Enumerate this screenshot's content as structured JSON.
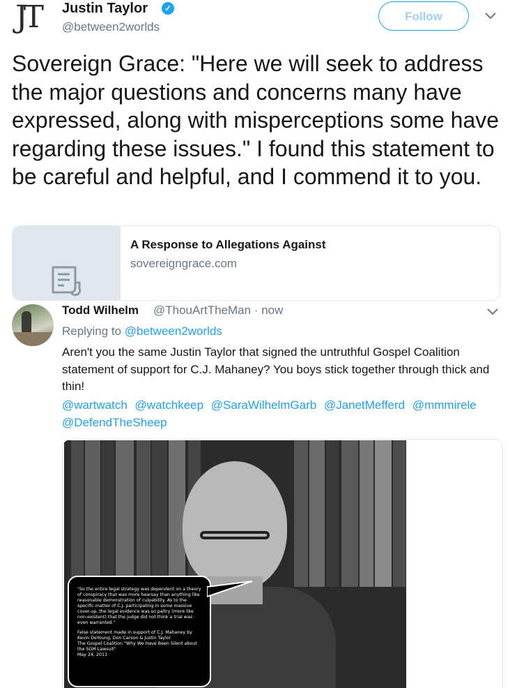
{
  "header": {
    "logo_text": "JT",
    "author_name": "Justin Taylor",
    "verified_icon": "verified-badge-icon",
    "handle": "@between2worlds",
    "follow_label": "Follow",
    "menu_icon": "chevron-down-icon"
  },
  "tweet": {
    "text": "Sovereign Grace: \"Here we will seek to address the major questions and concerns many have expressed, along with misperceptions some have regarding these issues.\" I found this statement to be careful and helpful, and I commend it to you."
  },
  "link_card": {
    "title": "A Response to Allegations Against",
    "domain": "sovereigngrace.com",
    "icon": "document-icon"
  },
  "reply": {
    "name": "Todd Wilhelm",
    "handle_time": "@ThouArtTheMan · now",
    "replying_prefix": "Replying to",
    "replying_to": "@between2worlds",
    "text": "Aren't you the same Justin Taylor that signed the untruthful Gospel Coalition statement of support for C.J. Mahaney? You boys stick together through thick and thin!",
    "mentions": [
      "@wartwatch",
      "@watchkeep",
      "@SaraWilhelmGarb",
      "@JanetMefferd",
      "@mmmirele",
      "@DefendTheSheep"
    ]
  },
  "media": {
    "caption_quote": "\"So the entire legal strategy was dependent on a theory of conspiracy that was more hearsay than anything like reasonable demonstration of culpability. As to the specific matter of C.J. participating in some massive cover-up, the legal evidence was so paltry (more like non-existent) that the judge did not think a trial was even warranted.\"",
    "caption_line1": "False statement made in support of C.J. Mahaney by",
    "caption_line2": "Kevin DeYoung, Don Carson & Justin Taylor",
    "caption_line3": "The Gospel Coalition \"Why We Have Been Silent about the SGM Lawsuit\"",
    "caption_line4": "May 24, 2013"
  },
  "colors": {
    "accent": "#1da1f2",
    "secondary_text": "#657786",
    "border": "#e1e8ed"
  }
}
